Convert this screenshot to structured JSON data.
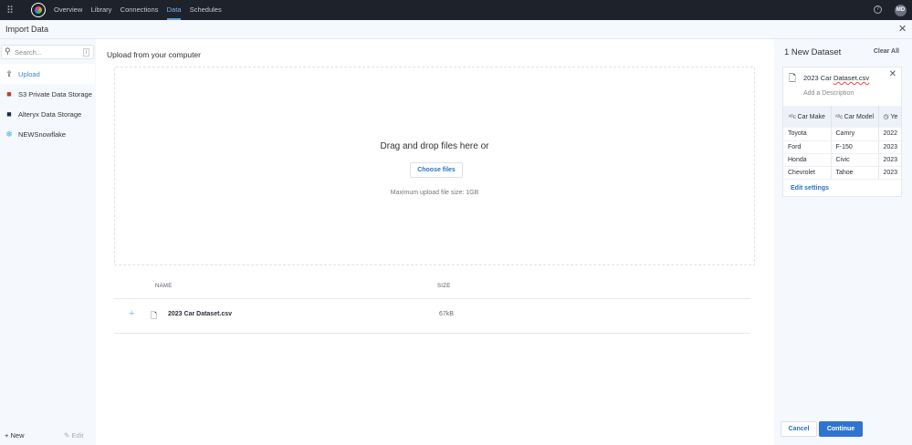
{
  "topnav": {
    "items": [
      "Overview",
      "Library",
      "Connections",
      "Data",
      "Schedules"
    ],
    "active": "Data",
    "avatar": "MD"
  },
  "header": {
    "title": "Import Data"
  },
  "sidebar": {
    "search_placeholder": "Search...",
    "search_shortcut": "/",
    "items": [
      {
        "label": "Upload"
      },
      {
        "label": "S3 Private Data Storage"
      },
      {
        "label": "Alteryx Data Storage"
      },
      {
        "label": "NEWSnowflake"
      }
    ],
    "new_label": "New",
    "edit_label": "Edit"
  },
  "main": {
    "title": "Upload from your computer",
    "drop_text": "Drag and drop files here or",
    "choose_files": "Choose files",
    "max_size": "Maximum upload file size: 1GB",
    "columns": {
      "name": "NAME",
      "size": "SIZE"
    },
    "files": [
      {
        "name": "2023 Car Dataset.csv",
        "size": "67kB"
      }
    ]
  },
  "panel": {
    "title": "1 New Dataset",
    "clear_all": "Clear All",
    "file_prefix": "2023 Car ",
    "file_suffix": "Dataset.csv",
    "description_placeholder": "Add a Description",
    "columns": [
      "Car Make",
      "Car Model",
      "Ye"
    ],
    "rows": [
      [
        "Toyota",
        "Camry",
        "2022"
      ],
      [
        "Ford",
        "F-150",
        "2023"
      ],
      [
        "Honda",
        "Civic",
        "2023"
      ],
      [
        "Chevrolet",
        "Tahoe",
        "2023"
      ]
    ],
    "edit_settings": "Edit settings",
    "cancel": "Cancel",
    "continue": "Continue"
  }
}
